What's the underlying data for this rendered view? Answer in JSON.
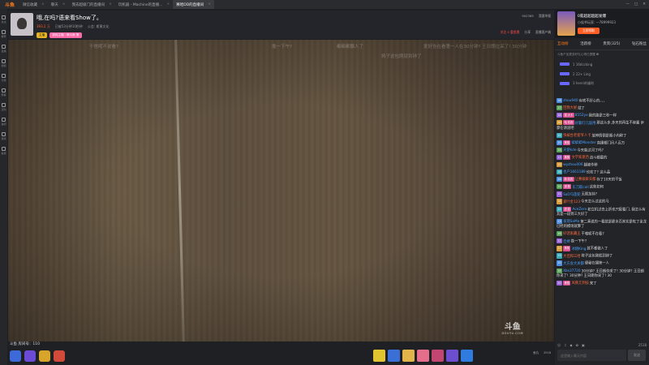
{
  "tabs": [
    {
      "label": "微信收藏",
      "active": false
    },
    {
      "label": "聊天",
      "active": false
    },
    {
      "label": "我去超级门的直播间",
      "active": false
    },
    {
      "label": "玩机器 - Machine的直播...",
      "active": false
    },
    {
      "label": "赛哈DD的直播间",
      "active": true
    }
  ],
  "logo": "斗鱼",
  "rail": [
    "关注",
    "推荐",
    "直播",
    "视频",
    "分类",
    "赛事",
    "活动",
    "鱼吧",
    "游戏",
    "鱼塘"
  ],
  "room": {
    "title": "哦,在吗?语来看Show了。",
    "hot": "393.2 万",
    "category": "已被53分钟10秒钟",
    "tag": "公会: 斯黄文化",
    "badges": [
      "主播",
      "游戏主播 · 萌斗鱼 第"
    ],
    "room_no": "902385",
    "report": "我要举报",
    "follow_label": "关注 0 重鱼票",
    "share": "分享",
    "client": "直播客户端"
  },
  "danmu": [
    "干啥呢不说看?",
    "挽一下午?",
    "都都都飘人了",
    "爱好告在看第一人在30分钟? 王日朗位采了! 30分钟",
    "将子这包刚就到钟了"
  ],
  "watermark": {
    "logo": "斗鱼",
    "domain": "DOUYU.COM"
  },
  "footer": {
    "room_id": "斗鱼 房间号：110",
    "fans_label": "鱼丸",
    "count": "2518"
  },
  "panel": {
    "ad": {
      "title": "0氪超超超超发爆",
      "sub": "小侯爷玩家: 一78999923",
      "btn": "立即领取",
      "corner": "广告"
    },
    "tabs": [
      "互动榜",
      "活跃榜",
      "贵宾(325)",
      "钻石粉丝"
    ],
    "rank_note": "斗鱼产品更多好礼心得已提醒 ❶",
    "ranks": [
      "1 16dccking",
      "2 22+ Ling",
      "3 henri的福利"
    ],
    "chat": [
      {
        "lvl": "16",
        "fan": "",
        "name": "zhou940",
        "text": "有啥不好心的、、、"
      },
      {
        "lvl": "17",
        "fan": "",
        "name": "回我大妮",
        "text": "就了"
      },
      {
        "lvl": "18",
        "fan": "菜·大卡",
        "name": "8552yx",
        "text": "我的路是三秒一样"
      },
      {
        "lvl": "20",
        "fan": "哈·初赛",
        "name": "好鲁叮几饭用",
        "text": "那这么多,多天的再生不容置 步骤在请道吧"
      },
      {
        "lvl": "21",
        "fan": "",
        "name": "快被台老套爷人卡",
        "text": "放神情倒是阁小内称了"
      },
      {
        "lvl": "15",
        "fan": "美丽",
        "name": "蚌蚌蚌Monster",
        "text": "直播都门月人百万"
      },
      {
        "lvl": "15",
        "fan": "",
        "name": "天使kde",
        "text": "今天能过河了吗?"
      },
      {
        "lvl": "13",
        "fan": "美丽",
        "name": "文学家意西",
        "text": "战斗都最的"
      },
      {
        "lvl": "12",
        "fan": "",
        "name": "wyzhou006",
        "text": "腿被作移"
      },
      {
        "lvl": "16",
        "fan": "",
        "name": "也户1661189",
        "text": "也欢了? 这么晶"
      },
      {
        "lvl": "18",
        "fan": "新·初赛",
        "name": "让赛级鲜天都",
        "text": "存了10天的干饭"
      },
      {
        "lvl": "21",
        "fan": "道·数",
        "name": "东刀取call",
        "text": "这些如何"
      },
      {
        "lvl": "11",
        "fan": "",
        "name": "SaD乌莲蛇",
        "text": "无限加持?"
      },
      {
        "lvl": "14",
        "fan": "",
        "name": "爱叶金123",
        "text": "今天怎么过这的马"
      },
      {
        "lvl": "15",
        "fan": "初·赛",
        "name": "AceZero",
        "text": "初立机过去上折也只配着门, 我怎么有其是一段到三大好了"
      },
      {
        "lvl": "13",
        "fan": "",
        "name": "发现SaMa",
        "text": "第二真说的一看就是那水页其实是吃了金龙已经的模场就算了"
      },
      {
        "lvl": "16",
        "fan": "",
        "name": "好话家藏王",
        "text": "干嗖呢不在看?"
      },
      {
        "lvl": "12",
        "fan": "",
        "name": "佳婷",
        "text": "挽一下午?"
      },
      {
        "lvl": "17",
        "fan": "美丽",
        "name": "冰随King",
        "text": "就不都做人了"
      },
      {
        "lvl": "19",
        "fan": "",
        "name": "大佳和三哈",
        "text": "将子这包刚就到钟了"
      },
      {
        "lvl": "10",
        "fan": "",
        "name": "大方会大关都",
        "text": "便秘在播第一人"
      },
      {
        "lvl": "15",
        "fan": "",
        "name": "Xbs37720",
        "text": "30分钟? 王日朗你采了! 30分钟? 王日朗你采了! 30分钟? 王日朗你采了! 30"
      },
      {
        "lvl": "20",
        "fan": "美丽",
        "name": "风蕉元到技",
        "text": "来了"
      }
    ],
    "tools": [
      "☺",
      "⇧",
      "◆",
      "✿",
      "▣",
      "2518"
    ],
    "input_placeholder": "这里输入聊天内容",
    "send_label": "发送"
  }
}
